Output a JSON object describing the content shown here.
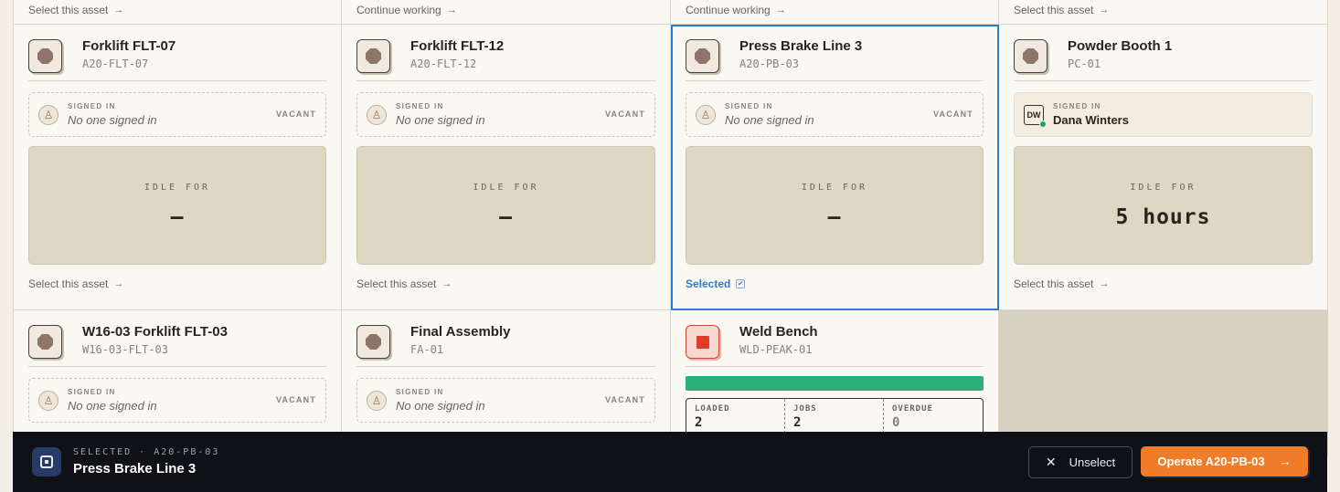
{
  "top_row": [
    {
      "link": "Select this asset"
    },
    {
      "link": "Continue working"
    },
    {
      "link": "Continue working"
    },
    {
      "link": "Select this asset"
    }
  ],
  "assets": [
    {
      "name": "Forklift FLT-07",
      "code": "A20-FLT-07",
      "signed_label": "SIGNED IN",
      "signed_value": "No one signed in",
      "vacant": "VACANT",
      "idle_label": "IDLE FOR",
      "idle_value": "—",
      "link": "Select this asset"
    },
    {
      "name": "Forklift FLT-12",
      "code": "A20-FLT-12",
      "signed_label": "SIGNED IN",
      "signed_value": "No one signed in",
      "vacant": "VACANT",
      "idle_label": "IDLE FOR",
      "idle_value": "—",
      "link": "Select this asset"
    },
    {
      "name": "Press Brake Line 3",
      "code": "A20-PB-03",
      "signed_label": "SIGNED IN",
      "signed_value": "No one signed in",
      "vacant": "VACANT",
      "idle_label": "IDLE FOR",
      "idle_value": "—",
      "link": "Selected"
    },
    {
      "name": "Powder Booth 1",
      "code": "PC-01",
      "signed_label": "SIGNED IN",
      "signed_value": "Dana Winters",
      "initials": "DW",
      "idle_label": "IDLE FOR",
      "idle_value": "5 hours",
      "link": "Select this asset"
    },
    {
      "name": "W16-03 Forklift FLT-03",
      "code": "W16-03-FLT-03",
      "signed_label": "SIGNED IN",
      "signed_value": "No one signed in",
      "vacant": "VACANT"
    },
    {
      "name": "Final Assembly",
      "code": "FA-01",
      "signed_label": "SIGNED IN",
      "signed_value": "No one signed in",
      "vacant": "VACANT"
    },
    {
      "name": "Weld Bench",
      "code": "WLD-PEAK-01",
      "progress": 1.0,
      "stats": [
        {
          "label": "LOADED",
          "value": "2"
        },
        {
          "label": "JOBS",
          "value": "2"
        },
        {
          "label": "OVERDUE",
          "value": "0"
        }
      ]
    }
  ],
  "bottom_bar": {
    "subtitle": "SELECTED · A20-PB-03",
    "title": "Press Brake Line 3",
    "unselect_label": "Unselect",
    "operate_label": "Operate A20-PB-03"
  },
  "colors": {
    "accent": "#f07c2a",
    "selected": "#2f7bd0",
    "progress": "#2bb07a",
    "alert": "#e03a2a"
  }
}
